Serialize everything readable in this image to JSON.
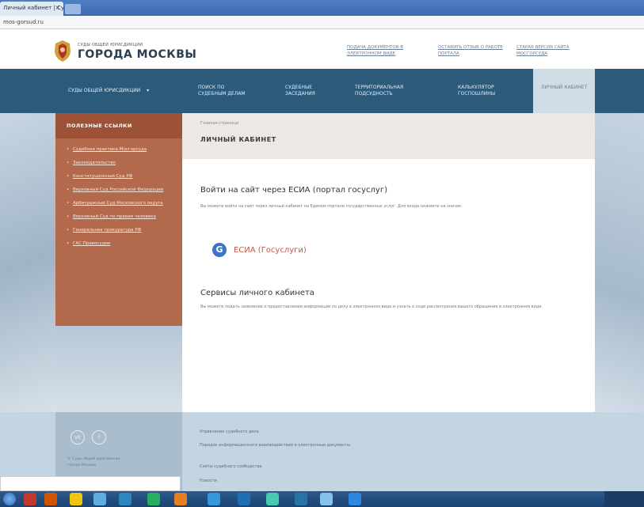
{
  "browser": {
    "tab_title": "Личный кабинет | Суд",
    "address": "mos-gorsud.ru"
  },
  "header": {
    "court_small": "СУДЫ ОБЩЕЙ ЮРИСДИКЦИИ",
    "court_big": "ГОРОДА МОСКВЫ",
    "links": [
      "ПОДАЧА ДОКУМЕНТОВ В ЭЛЕКТРОННОМ ВИДЕ",
      "ОСТАВИТЬ ОТЗЫВ О РАБОТЕ ПОРТАЛА",
      "СТАРАЯ ВЕРСИЯ САЙТА МОСГОРСУДА"
    ]
  },
  "nav": {
    "items": [
      "СУДЫ ОБЩЕЙ ЮРИСДИКЦИИ",
      "ПОИСК ПО СУДЕБНЫМ ДЕЛАМ",
      "СУДЕБНЫЕ ЗАСЕДАНИЯ",
      "ТЕРРИТОРИАЛЬНАЯ ПОДСУДНОСТЬ",
      "КАЛЬКУЛЯТОР ГОСПОШЛИНЫ",
      "ЛИЧНЫЙ КАБИНЕТ"
    ],
    "dropdown_glyph": "▾"
  },
  "sidebar": {
    "title": "ПОЛЕЗНЫЕ ССЫЛКИ",
    "items": [
      "Судебная практика Мосгорсуда",
      "Законодательство",
      "Конституционный Суд РФ",
      "Верховный Суд Российской Федерации",
      "Арбитражный Суд Московского округа",
      "Верховный Суд по правам человека",
      "Генеральная прокуратура РФ",
      "ГАС Правосудие"
    ]
  },
  "main": {
    "breadcrumb": "Главная страница",
    "title": "ЛИЧНЫЙ КАБИНЕТ",
    "login_heading": "Войти на сайт через ЕСИА (портал госуслуг)",
    "login_note": "Вы можете войти на сайт через личный кабинет на Едином портале государственных услуг. Для входа нажмите на значок.",
    "esia_label": "ЕСИА (Госуслуги)",
    "services_heading": "Сервисы личного кабинета",
    "services_note": "Вы можете подать заявление о предоставлении информации по делу в электронном виде и узнать о ходе рассмотрения вашего обращения в электронном виде."
  },
  "footer": {
    "social": [
      "vk",
      "f"
    ],
    "small_lines": [
      "© Суды общей юрисдикции",
      "города Москвы"
    ],
    "lines": [
      "Управление судебного дела",
      "Порядок информационного взаимодействия и электронные документы",
      "Сайты судебного сообщества",
      "Новости"
    ]
  },
  "colors": {
    "nav": "#2c5a7b",
    "sidebar": "#b2694c",
    "esia_icon": "#3a76c4",
    "esia_label": "#c05a4a"
  }
}
